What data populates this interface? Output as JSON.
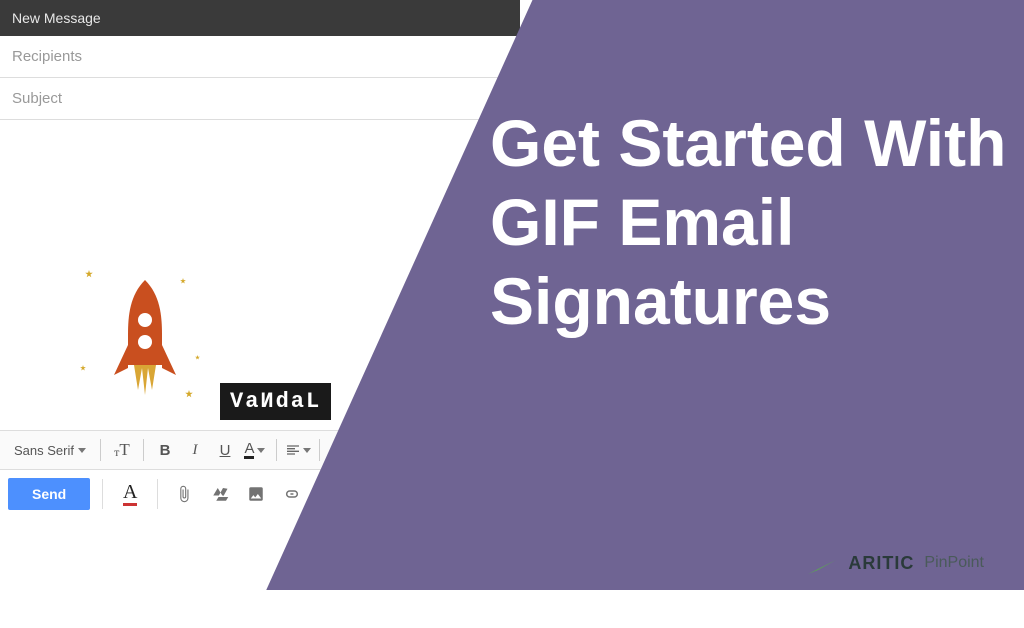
{
  "compose": {
    "header": "New Message",
    "recipients_placeholder": "Recipients",
    "subject_placeholder": "Subject",
    "font_family": "Sans Serif",
    "send_label": "Send",
    "text_color_letter": "A"
  },
  "signature": {
    "badge_text": "VaИdaL"
  },
  "format_buttons": {
    "font_size": "T",
    "bold": "B",
    "italic": "I",
    "underline": "U",
    "color": "A"
  },
  "overlay": {
    "title": "Get Started With GIF Email Signatures"
  },
  "brand": {
    "name": "ARITIC",
    "product": "PinPoint"
  }
}
